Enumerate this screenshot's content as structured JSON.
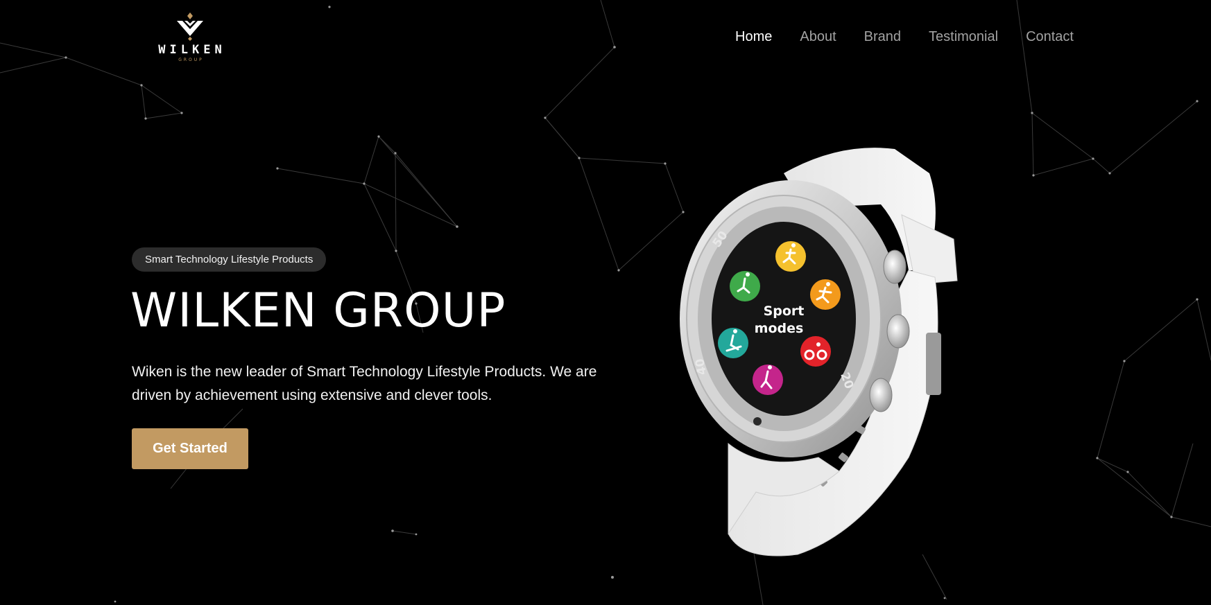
{
  "logo": {
    "wordmark": "WILKEN",
    "sub": "GROUP",
    "accent_color": "#c29a62"
  },
  "nav": {
    "items": [
      {
        "label": "Home",
        "active": true
      },
      {
        "label": "About",
        "active": false
      },
      {
        "label": "Brand",
        "active": false
      },
      {
        "label": "Testimonial",
        "active": false
      },
      {
        "label": "Contact",
        "active": false
      }
    ]
  },
  "hero": {
    "badge": "Smart Technology Lifestyle Products",
    "title": "WILKEN GROUP",
    "description": "Wiken is the new leader of Smart Technology Lifestyle Products. We are driven by achievement using extensive and clever tools.",
    "cta_label": "Get Started",
    "cta_color": "#c29a62"
  },
  "watch": {
    "screen_text_line1": "Sport",
    "screen_text_line2": "modes",
    "bezel_numbers": [
      "50",
      "40",
      "20"
    ],
    "mode_icons": [
      {
        "name": "running-icon",
        "color": "#f5c12e"
      },
      {
        "name": "sprint-icon",
        "color": "#f39a1c"
      },
      {
        "name": "cycling-icon",
        "color": "#e2232a"
      },
      {
        "name": "hiking-icon",
        "color": "#c4258b"
      },
      {
        "name": "skiing-icon",
        "color": "#23a89b"
      },
      {
        "name": "triathlon-icon",
        "color": "#3faa4a"
      }
    ]
  },
  "colors": {
    "background": "#000000",
    "nav_active": "#ffffff",
    "nav_inactive": "#a3a3a3",
    "badge_bg": "#2c2c2c"
  }
}
